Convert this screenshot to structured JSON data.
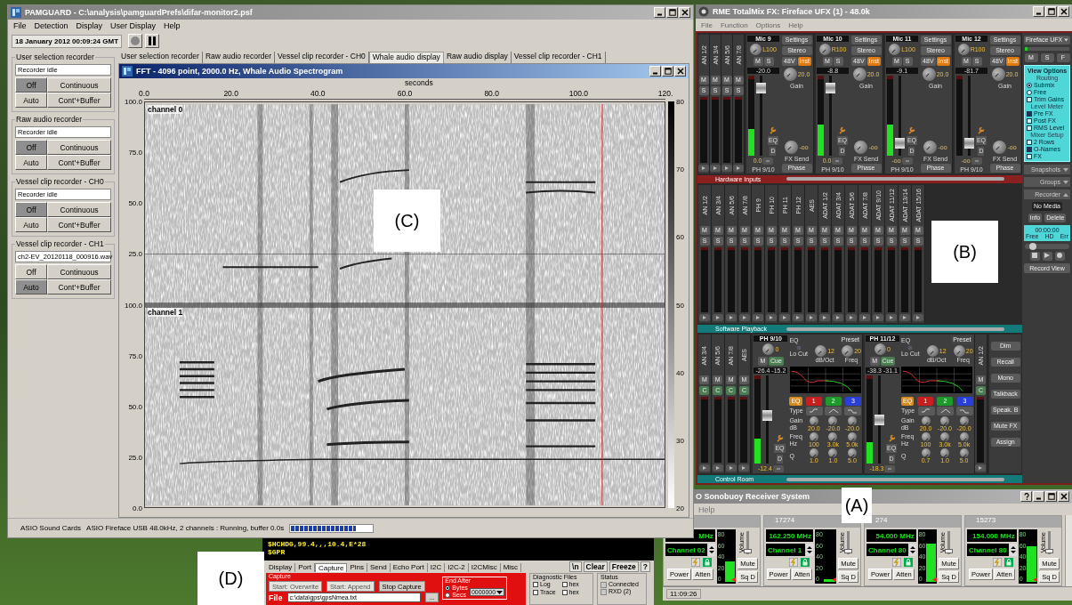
{
  "pamguard": {
    "title": "PAMGUARD - C:\\analysis\\pamguardPrefs\\difar-monitor2.psf",
    "menu": [
      "File",
      "Detection",
      "Display",
      "User Display",
      "Help"
    ],
    "clock": "18 January 2012 00:09:24 GMT",
    "recorders": [
      {
        "title": "User selection recorder",
        "status": "Recorder idle",
        "modes": [
          {
            "label": "Off",
            "selected": true
          },
          {
            "label": "Continuous",
            "selected": false
          },
          {
            "label": "Auto",
            "selected": false
          },
          {
            "label": "Cont'+Buffer",
            "selected": false
          }
        ]
      },
      {
        "title": "Raw audio recorder",
        "status": "Recorder idle",
        "modes": [
          {
            "label": "Off",
            "selected": true
          },
          {
            "label": "Continuous",
            "selected": false
          },
          {
            "label": "Auto",
            "selected": false
          },
          {
            "label": "Cont'+Buffer",
            "selected": false
          }
        ]
      },
      {
        "title": "Vessel clip recorder - CH0",
        "status": "Recorder idle",
        "modes": [
          {
            "label": "Off",
            "selected": true
          },
          {
            "label": "Continuous",
            "selected": false
          },
          {
            "label": "Auto",
            "selected": false
          },
          {
            "label": "Cont'+Buffer",
            "selected": false
          }
        ]
      },
      {
        "title": "Vessel clip recorder - CH1",
        "status": "ch2-EV_20120118_000916.wav",
        "modes": [
          {
            "label": "Off",
            "selected": false
          },
          {
            "label": "Continuous",
            "selected": false
          },
          {
            "label": "Auto",
            "selected": true
          },
          {
            "label": "Cont'+Buffer",
            "selected": false
          }
        ]
      }
    ],
    "tabs": [
      {
        "label": "User selection recorder",
        "selected": false
      },
      {
        "label": "Raw audio recorder",
        "selected": false
      },
      {
        "label": "Vessel clip recorder - CH0",
        "selected": false
      },
      {
        "label": "Whale audio display",
        "selected": true
      },
      {
        "label": "Raw audio display",
        "selected": false
      },
      {
        "label": "Vessel clip recorder - CH1",
        "selected": false
      }
    ],
    "spectrogram": {
      "title": "FFT - 4096 point, 2000.0 Hz, Whale Audio Spectrogram",
      "xlabel": "seconds",
      "xticks": [
        "0.0",
        "20.0",
        "40.0",
        "60.0",
        "80.0",
        "100.0",
        "120."
      ],
      "panels": [
        {
          "label": "channel 0",
          "yticks": [
            "100.0",
            "75.0",
            "50.0",
            "25.0"
          ]
        },
        {
          "label": "channel 1",
          "yticks": [
            "100.0",
            "75.0",
            "50.0",
            "25.0",
            "0.0"
          ]
        }
      ],
      "colorbar_ticks": [
        "80",
        "70",
        "60",
        "50",
        "40",
        "30",
        "20"
      ]
    },
    "status_bar": {
      "source": "ASIO Sound Cards",
      "info": "ASIO Fireface USB 48.0kHz, 2 channels : Running, buffer 0.0s",
      "buffer": {
        "level": 0.8
      }
    }
  },
  "totalmix": {
    "title": "RME TotalMix FX: Fireface UFX (1) - 48.0k",
    "menu": [
      "File",
      "Function",
      "Options",
      "Help"
    ],
    "inputs": {
      "label": "Hardware Inputs",
      "narrow": [
        {
          "name": "AN 1/2",
          "buttons": [
            "M",
            "S"
          ]
        },
        {
          "name": "AN 3/4",
          "buttons": [
            "M",
            "S"
          ]
        },
        {
          "name": "AN 5/6",
          "buttons": [
            "M",
            "S"
          ]
        },
        {
          "name": "AN 7/8",
          "buttons": [
            "M",
            "S"
          ]
        }
      ],
      "strips": [
        {
          "name": "Mic 9",
          "pan": "L100",
          "buttons": [
            "M",
            "S"
          ],
          "level": "-20.0",
          "meter": {
            "level": 0.35
          },
          "fader": {
            "level": 0.9
          },
          "reading": "0.0",
          "route": "PH 9/10",
          "tools": [
            "EQ",
            "D"
          ],
          "settings": {
            "title": "Settings",
            "stereo": "Stereo",
            "phantom": {
              "label": "48V",
              "on": false
            },
            "inst": {
              "label": "Inst",
              "on": true
            },
            "gain": "20.0",
            "gain_label": "Gain",
            "fx": "-oo",
            "fx_label": "FX Send",
            "phase": "Phase"
          }
        },
        {
          "name": "Mic 10",
          "pan": "R100",
          "buttons": [
            "M",
            "S"
          ],
          "level": "-8.8",
          "meter": {
            "level": 0.4
          },
          "fader": {
            "level": 0.9
          },
          "reading": "0.0",
          "route": "PH 9/10",
          "tools": [
            "EQ",
            "D"
          ],
          "settings": {
            "title": "Settings",
            "stereo": "Stereo",
            "phantom": {
              "label": "48V",
              "on": false
            },
            "inst": {
              "label": "Inst",
              "on": true
            },
            "gain": "20.0",
            "gain_label": "Gain",
            "fx": "-oo",
            "fx_label": "FX Send",
            "phase": "Phase"
          }
        },
        {
          "name": "Mic 11",
          "pan": "L100",
          "buttons": [
            "M",
            "S"
          ],
          "level": "-9.1",
          "meter": {
            "level": 0.4
          },
          "fader": {
            "level": 0.1
          },
          "reading": "-oo",
          "route": "PH 9/10",
          "tools": [
            "EQ",
            "D"
          ],
          "settings": {
            "title": "Settings",
            "stereo": "Stereo",
            "phantom": {
              "label": "48V",
              "on": false
            },
            "inst": {
              "label": "Inst",
              "on": true
            },
            "gain": "20.0",
            "gain_label": "Gain",
            "fx": "-oo",
            "fx_label": "FX Send",
            "phase": "Phase"
          }
        },
        {
          "name": "Mic 12",
          "pan": "R100",
          "buttons": [
            "M",
            "S"
          ],
          "level": "-81.7",
          "fader": {
            "level": 0.1
          },
          "reading": "-oo",
          "route": "PH 9/10",
          "tools": [
            "EQ",
            "D"
          ],
          "settings": {
            "title": "Settings",
            "stereo": "Stereo",
            "phantom": {
              "label": "48V",
              "on": false
            },
            "inst": {
              "label": "Inst",
              "on": true
            },
            "gain": "20.0",
            "gain_label": "Gain",
            "fx": "-oo",
            "fx_label": "FX Send",
            "phase": "Phase"
          }
        }
      ]
    },
    "playback": {
      "label": "Software Playback",
      "channels": [
        {
          "name": "AN 1/2",
          "buttons": [
            "M",
            "S"
          ]
        },
        {
          "name": "AN 3/4",
          "buttons": [
            "M",
            "S"
          ]
        },
        {
          "name": "AN 5/6",
          "buttons": [
            "M",
            "S"
          ]
        },
        {
          "name": "AN 7/8",
          "buttons": [
            "M",
            "S"
          ]
        },
        {
          "name": "PH 9",
          "buttons": [
            "M",
            "S"
          ]
        },
        {
          "name": "PH 10",
          "buttons": [
            "M",
            "S"
          ]
        },
        {
          "name": "PH 11",
          "buttons": [
            "M",
            "S"
          ]
        },
        {
          "name": "PH 12",
          "buttons": [
            "M",
            "S"
          ]
        },
        {
          "name": "AES",
          "buttons": [
            "M",
            "S"
          ]
        },
        {
          "name": "ADAT 1/2",
          "buttons": [
            "M",
            "S"
          ]
        },
        {
          "name": "ADAT 3/4",
          "buttons": [
            "M",
            "S"
          ]
        },
        {
          "name": "ADAT 5/6",
          "buttons": [
            "M",
            "S"
          ]
        },
        {
          "name": "ADAT 7/8",
          "buttons": [
            "M",
            "S"
          ]
        },
        {
          "name": "ADAT 9/10",
          "buttons": [
            "M",
            "S"
          ]
        },
        {
          "name": "ADAT 11/12",
          "buttons": [
            "M",
            "S"
          ]
        },
        {
          "name": "ADAT 13/14",
          "buttons": [
            "M",
            "S"
          ]
        },
        {
          "name": "ADAT 15/16",
          "buttons": [
            "M",
            "S"
          ]
        }
      ]
    },
    "control_room": {
      "label": "Control Room",
      "narrow_left": [
        {
          "name": "AN 3/4",
          "buttons": [
            "M",
            "C"
          ]
        },
        {
          "name": "AN 5/6",
          "buttons": [
            "M",
            "C"
          ]
        },
        {
          "name": "AN 7/8",
          "buttons": [
            "M",
            "C"
          ]
        },
        {
          "name": "AES",
          "buttons": [
            "M",
            "C"
          ]
        }
      ],
      "strips": [
        {
          "name": "PH 9/10",
          "pan": "0",
          "buttons": [
            "M",
            "Cue"
          ],
          "levels": "-26.4 -15.2",
          "meter": {
            "level": 0.3
          },
          "fader": {
            "level": 0.55
          },
          "reading": "-12.4",
          "tools": [
            "EQ",
            "D"
          ],
          "eq": {
            "title": "EQ",
            "preset": "Preset",
            "locut": "Lo Cut",
            "slope": "12",
            "slope_label": "dB/Oct",
            "cut_freq": "20",
            "cut_freq_label": "Freq",
            "toggle": {
              "label": "EQ",
              "on": true
            },
            "bands": [
              {
                "label": "1",
                "color": "#c81e1e"
              },
              {
                "label": "2",
                "color": "#1e9a2a"
              },
              {
                "label": "3",
                "color": "#2a3ed8"
              }
            ],
            "type_label": "Type",
            "rows": [
              {
                "label": "Gain dB",
                "values": [
                  "20.0",
                  "-20.0",
                  "-20.0"
                ]
              },
              {
                "label": "Freq Hz",
                "values": [
                  "100",
                  "3.0k",
                  "5.0k"
                ]
              },
              {
                "label": "Q",
                "values": [
                  "1.0",
                  "1.0",
                  "5.0"
                ]
              }
            ]
          }
        },
        {
          "name": "PH 11/12",
          "pan": "0",
          "buttons": [
            "M",
            "Cue"
          ],
          "levels": "-38.3 -31.1",
          "meter": {
            "level": 0.25
          },
          "fader": {
            "level": 0.5
          },
          "reading": "-18.3",
          "tools": [
            "EQ",
            "D"
          ],
          "eq": {
            "title": "EQ",
            "preset": "Preset",
            "locut": "Lo Cut",
            "slope": "12",
            "slope_label": "dB/Oct",
            "cut_freq": "20",
            "cut_freq_label": "Freq",
            "toggle": {
              "label": "EQ",
              "on": true
            },
            "bands": [
              {
                "label": "1",
                "color": "#c81e1e"
              },
              {
                "label": "2",
                "color": "#1e9a2a"
              },
              {
                "label": "3",
                "color": "#2a3ed8"
              }
            ],
            "type_label": "Type",
            "rows": [
              {
                "label": "Gain dB",
                "values": [
                  "20.0",
                  "-20.0",
                  "-20.0"
                ]
              },
              {
                "label": "Freq Hz",
                "values": [
                  "100",
                  "3.0k",
                  "5.0k"
                ]
              },
              {
                "label": "Q",
                "values": [
                  "0.7",
                  "1.0",
                  "5.0"
                ]
              }
            ]
          }
        }
      ],
      "narrow_right": [
        {
          "name": "AN 1/2",
          "buttons": [
            "M",
            "C"
          ]
        }
      ],
      "buttons": [
        "Dim",
        "Recall",
        "Mono",
        "Talkback",
        "Speak. B",
        "Mute FX",
        "Assign"
      ]
    },
    "side": {
      "device": "Fireface UFX",
      "buttons": [
        "M",
        "S",
        "F"
      ],
      "view_options": {
        "title": "View Options",
        "sections": [
          {
            "title": "Routing",
            "items": [
              {
                "kind": "radio",
                "label": "Submix",
                "checked": true
              },
              {
                "kind": "radio",
                "label": "Free",
                "checked": false
              },
              {
                "kind": "checkbox",
                "label": "Trim Gains",
                "checked": false
              }
            ]
          },
          {
            "title": "Level Meter",
            "items": [
              {
                "kind": "checkbox",
                "label": "Pre FX",
                "checked": true
              },
              {
                "kind": "checkbox",
                "label": "Post FX",
                "checked": false
              },
              {
                "kind": "checkbox",
                "label": "RMS Level",
                "checked": false
              }
            ]
          },
          {
            "title": "Mixer Setup",
            "items": [
              {
                "kind": "checkbox",
                "label": "2 Rows",
                "checked": false
              },
              {
                "kind": "checkbox",
                "label": "O-Names",
                "checked": true
              },
              {
                "kind": "checkbox",
                "label": "FX",
                "checked": false
              }
            ]
          }
        ]
      },
      "panels": [
        {
          "label": "Snapshots",
          "expanded": false
        },
        {
          "label": "Groups",
          "expanded": false
        },
        {
          "label": "Recorder",
          "expanded": true
        }
      ],
      "recorder": {
        "media": "No Media",
        "buttons": [
          "Info",
          "Delete"
        ],
        "time": "00:00:00",
        "labels": [
          "Free",
          "HD",
          "Err"
        ],
        "position": {
          "level": 0.12
        },
        "record_view": "Record View"
      }
    }
  },
  "sonobuoy": {
    "title": "O Sonobuoy Receiver System",
    "menu": [
      "Help"
    ],
    "channels": [
      {
        "freq": "MHz",
        "channel": "Channel 02",
        "meter": {
          "level": 0.4
        },
        "scale": [
          "80",
          "60",
          "40",
          "20",
          "0"
        ],
        "volume": "Volume",
        "volume_slider": {
          "level": 0.05
        },
        "mute": "Mute",
        "squelch": "Sq D",
        "power": "Power",
        "atten": "Atten"
      },
      {
        "id": "17274",
        "freq": "162.250 MHz",
        "channel": "Channel 1",
        "meter": {
          "level": 0.06
        },
        "scale": [
          "80",
          "60",
          "40",
          "20",
          "0"
        ],
        "volume": "Volume",
        "volume_slider": {
          "level": 0.05
        },
        "mute": "Mute",
        "squelch": "Sq D",
        "power": "Power",
        "atten": "Atten"
      },
      {
        "id": "274",
        "freq": "54.000 MHz",
        "channel": "Channel 80",
        "meter": {
          "level": 0.75
        },
        "scale": [
          "80",
          "60",
          "40",
          "20",
          "0"
        ],
        "volume": "Volume",
        "volume_slider": {
          "level": 0.05
        },
        "mute": "Mute",
        "squelch": "Sq D",
        "power": "Power",
        "atten": "Atten"
      },
      {
        "id": "15273",
        "freq": "154.000 MHz",
        "channel": "Channel 80",
        "meter": {
          "level": 0.7
        },
        "scale": [
          "80",
          "60",
          "40",
          "20",
          "0"
        ],
        "volume": "Volume",
        "volume_slider": {
          "level": 0.05
        },
        "mute": "Mute",
        "squelch": "Sq D",
        "power": "Power",
        "atten": "Atten"
      }
    ],
    "status_time": "11:09:26"
  },
  "serial_monitor": {
    "lines": [
      "$HCHDG,99.4,,,10.4,E*28",
      "$GPR"
    ],
    "tabs": [
      {
        "label": "Display",
        "selected": false
      },
      {
        "label": "Port",
        "selected": false
      },
      {
        "label": "Capture",
        "selected": true
      },
      {
        "label": "Pins",
        "selected": false
      },
      {
        "label": "Send",
        "selected": false
      },
      {
        "label": "Echo Port",
        "selected": false
      },
      {
        "label": "I2C",
        "selected": false
      },
      {
        "label": "I2C-2",
        "selected": false
      },
      {
        "label": "I2CMisc",
        "selected": false
      },
      {
        "label": "Misc",
        "selected": false
      }
    ],
    "tools": [
      "\\n",
      "Clear",
      "Freeze",
      "?"
    ],
    "capture": {
      "title": "Capture",
      "buttons": [
        {
          "label": "Start: Overwrite",
          "disabled": true
        },
        {
          "label": "Start: Append",
          "disabled": true
        },
        {
          "label": "Stop Capture",
          "disabled": false
        }
      ],
      "end_after": {
        "title": "End After",
        "options": [
          {
            "label": "Bytes",
            "selected": true
          },
          {
            "label": "Secs",
            "selected": false
          }
        ],
        "value": "0000000"
      },
      "file_label": "File",
      "file": "c:\\data\\gps\\gpsNmea.txt",
      "browse": "..."
    },
    "diagnostic": {
      "title": "Diagnostic Files",
      "items": [
        {
          "label": "Log",
          "checked": false
        },
        {
          "label": "hex",
          "checked": false
        },
        {
          "label": "Trace",
          "checked": false
        },
        {
          "label": "hex",
          "checked": false
        }
      ]
    },
    "status": {
      "title": "Status",
      "items": [
        "Connected",
        "RXD (2)"
      ]
    }
  },
  "overlay_labels": [
    "(C)",
    "(B)",
    "(A)",
    "(D)"
  ]
}
